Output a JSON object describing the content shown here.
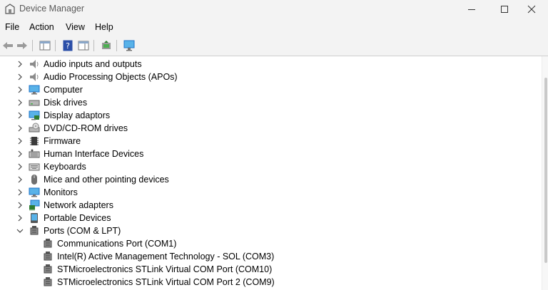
{
  "window": {
    "title": "Device Manager"
  },
  "menu": [
    "File",
    "Action",
    "View",
    "Help"
  ],
  "toolbar": [
    "back-icon",
    "forward-icon",
    "properties-view-icon",
    "help-icon",
    "action-pane-icon",
    "update-driver-icon",
    "scan-hardware-icon"
  ],
  "tree": {
    "categories": [
      {
        "label": "Audio inputs and outputs",
        "icon": "speaker-icon",
        "expanded": false
      },
      {
        "label": "Audio Processing Objects (APOs)",
        "icon": "speaker-icon",
        "expanded": false
      },
      {
        "label": "Computer",
        "icon": "computer-icon",
        "expanded": false
      },
      {
        "label": "Disk drives",
        "icon": "disk-drive-icon",
        "expanded": false
      },
      {
        "label": "Display adaptors",
        "icon": "display-adapter-icon",
        "expanded": false
      },
      {
        "label": "DVD/CD-ROM drives",
        "icon": "dvd-drive-icon",
        "expanded": false
      },
      {
        "label": "Firmware",
        "icon": "firmware-chip-icon",
        "expanded": false
      },
      {
        "label": "Human Interface Devices",
        "icon": "hid-keyboard-icon",
        "expanded": false
      },
      {
        "label": "Keyboards",
        "icon": "keyboard-icon",
        "expanded": false
      },
      {
        "label": "Mice and other pointing devices",
        "icon": "mouse-icon",
        "expanded": false
      },
      {
        "label": "Monitors",
        "icon": "monitor-icon",
        "expanded": false
      },
      {
        "label": "Network adapters",
        "icon": "network-adapter-icon",
        "expanded": false
      },
      {
        "label": "Portable Devices",
        "icon": "portable-device-icon",
        "expanded": false
      },
      {
        "label": "Ports (COM & LPT)",
        "icon": "port-icon",
        "expanded": true
      }
    ],
    "ports_children": [
      {
        "label": "Communications Port (COM1)",
        "icon": "port-icon"
      },
      {
        "label": "Intel(R) Active Management Technology - SOL (COM3)",
        "icon": "port-icon"
      },
      {
        "label": "STMicroelectronics STLink Virtual COM Port (COM10)",
        "icon": "port-icon"
      },
      {
        "label": "STMicroelectronics STLink Virtual COM Port 2 (COM9)",
        "icon": "port-icon"
      }
    ]
  },
  "colors": {
    "chrome": "#f3f3f3",
    "blue": "#1e73c8",
    "screen": "#58b2e8"
  }
}
